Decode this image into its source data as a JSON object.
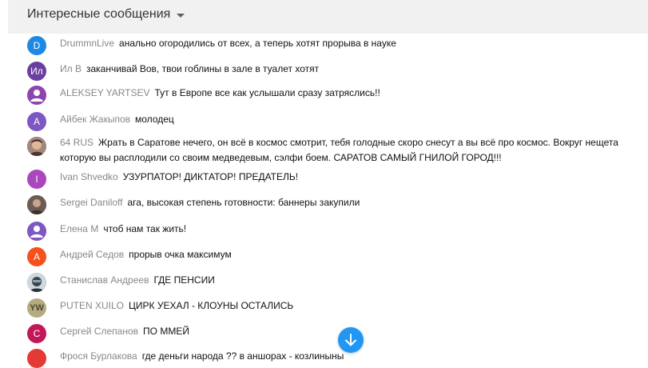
{
  "header": {
    "title": "Интересные сообщения"
  },
  "messages": [
    {
      "author": "DrummnLive",
      "initial": "D",
      "color": "#1e88e5",
      "text": "анально огородились от всех, а теперь хотят прорыва в науке"
    },
    {
      "author": "Ил В",
      "initial": "Ил",
      "color": "#6a3fa0",
      "text": "заканчивай Вов, твои гоблины в зале в туалет хотят"
    },
    {
      "author": "ALEKSEY YARTSEV",
      "initial": "",
      "color": "#8e44ad",
      "text": "Тут в Европе все как услышали сразу затряслись!!"
    },
    {
      "author": "Айбек Жакыпов",
      "initial": "А",
      "color": "#7e57c2",
      "text": "молодец"
    },
    {
      "author": "64 RUS",
      "initial": "",
      "color": "#8d6e63",
      "text": "Жрать в Саратове нечего, он всё в космос смотрит, тебя голодные скоро снесут а вы всё про космос. Вокруг нещета которую вы расплодили со своим медведевым, сэлфи боем. САРАТОВ САМЫЙ ГНИЛОЙ ГОРОД!!!"
    },
    {
      "author": "Ivan Shvedko",
      "initial": "I",
      "color": "#ab47bc",
      "text": "УЗУРПАТОР! ДИКТАТОР! ПРЕДАТЕЛЬ!"
    },
    {
      "author": "Sergei Daniloff",
      "initial": "",
      "color": "#6d5c55",
      "text": "ага, высокая степень готовности: баннеры закупили"
    },
    {
      "author": "Елена М",
      "initial": "",
      "color": "#7e57c2",
      "text": "чтоб нам так жить!"
    },
    {
      "author": "Андрей Седов",
      "initial": "А",
      "color": "#f4511e",
      "text": "прорыв очка максимум"
    },
    {
      "author": "Станислав Андреев",
      "initial": "",
      "color": "#546e7a",
      "text": "ГДЕ ПЕНСИИ"
    },
    {
      "author": "PUTEN XUILO",
      "initial": "YW",
      "color": "#8d8358",
      "text": "ЦИРК УЕХАЛ - КЛОУНЫ ОСТАЛИСЬ"
    },
    {
      "author": "Сергей Слепанов",
      "initial": "С",
      "color": "#c2185b",
      "text": "ПО ММЕЙ"
    },
    {
      "author": "Фрося Бурлакова",
      "initial": "",
      "color": "#e53935",
      "text": "где деньги народа ?? в аншорах - козлиныны"
    }
  ],
  "icons": {
    "dropdown": "caret-down-icon",
    "scroll": "arrow-down-icon"
  }
}
